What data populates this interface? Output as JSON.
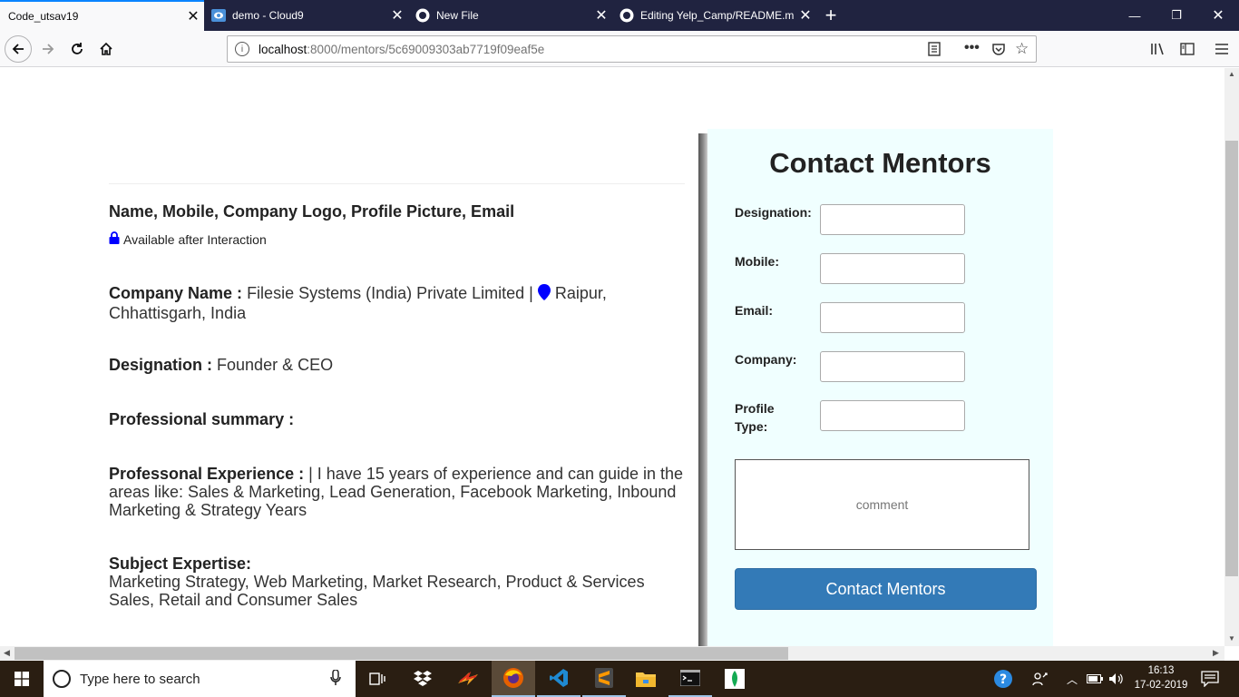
{
  "tabs": [
    {
      "label": "Code_utsav19",
      "active": true
    },
    {
      "label": "demo - Cloud9",
      "active": false
    },
    {
      "label": "New File",
      "active": false
    },
    {
      "label": "Editing Yelp_Camp/README.m",
      "active": false
    }
  ],
  "url": {
    "host": "localhost",
    "path": ":8000/mentors/5c69009303ab7719f09eaf5e"
  },
  "profile": {
    "hidden_fields": "Name, Mobile, Company Logo, Profile Picture, Email",
    "availability": "Available after Interaction",
    "company_label": "Company Name :",
    "company_value": "Filesie Systems (India) Private Limited |",
    "location_line1": "Raipur,",
    "location_line2": "Chhattisgarh, India",
    "designation_label": "Designation :",
    "designation_value": "Founder & CEO",
    "summary_label": "Professional summary :",
    "experience_label": "Professonal Experience :",
    "experience_line1": "| I have 15 years of experience and can guide in the",
    "experience_line2": "areas like: Sales & Marketing, Lead Generation, Facebook Marketing, Inbound",
    "experience_line3": "Marketing & Strategy Years",
    "expertise_label": "Subject Expertise:",
    "expertise_line1": "Marketing Strategy, Web Marketing, Market Research, Product & Services",
    "expertise_line2": "Sales, Retail and Consumer Sales"
  },
  "contact_form": {
    "title": "Contact Mentors",
    "designation_label": "Designation:",
    "mobile_label": "Mobile:",
    "email_label": "Email:",
    "company_label": "Company:",
    "profile_type_label_1": "Profile",
    "profile_type_label_2": "Type:",
    "comment_placeholder": "comment",
    "submit_label": "Contact Mentors"
  },
  "taskbar": {
    "search_placeholder": "Type here to search",
    "time": "16:13",
    "date": "17-02-2019"
  },
  "colors": {
    "accent": "#0a84ff",
    "tabbar": "#202340",
    "panel": "#f0ffff",
    "submit": "#337ab7",
    "location_pin": "#0000ff",
    "lock_icon": "#0000ff"
  }
}
